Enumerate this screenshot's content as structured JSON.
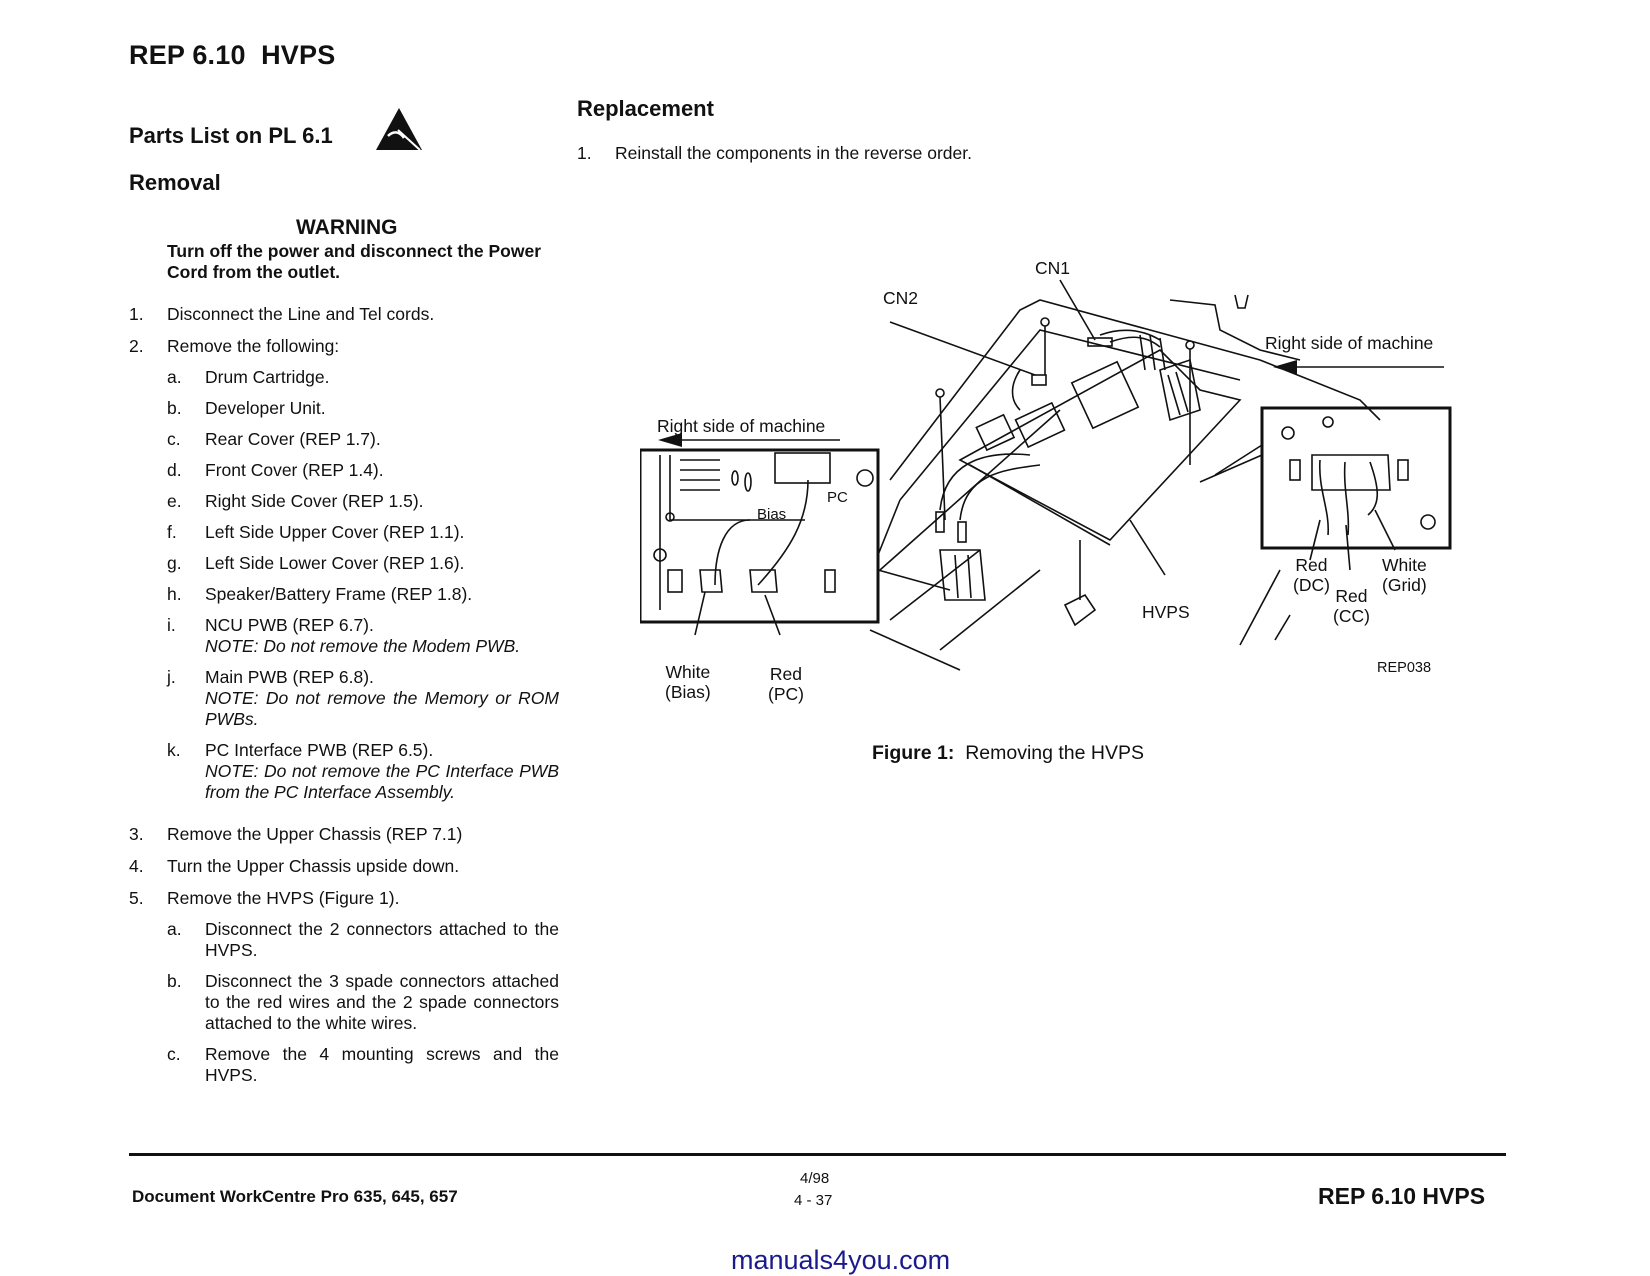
{
  "header": {
    "title": "REP 6.10  HVPS"
  },
  "left": {
    "parts_heading": "Parts List on PL 6.1",
    "esd_icon": "esd-warning-triangle-icon",
    "removal_heading": "Removal",
    "warning": {
      "title": "WARNING",
      "text": "Turn off the power and disconnect the Power Cord from the outlet."
    },
    "steps": [
      {
        "num": "1.",
        "text": "Disconnect the Line and Tel cords."
      },
      {
        "num": "2.",
        "text": "Remove the following:",
        "subs": [
          {
            "letter": "a.",
            "text": "Drum Cartridge."
          },
          {
            "letter": "b.",
            "text": "Developer Unit."
          },
          {
            "letter": "c.",
            "text": "Rear Cover (REP 1.7)."
          },
          {
            "letter": "d.",
            "text": "Front Cover (REP 1.4)."
          },
          {
            "letter": "e.",
            "text": "Right Side Cover (REP 1.5)."
          },
          {
            "letter": "f.",
            "text": "Left Side Upper Cover (REP 1.1)."
          },
          {
            "letter": "g.",
            "text": "Left Side Lower Cover (REP 1.6)."
          },
          {
            "letter": "h.",
            "text": "Speaker/Battery Frame (REP 1.8)."
          },
          {
            "letter": "i.",
            "text": "NCU PWB (REP 6.7).",
            "note": "NOTE: Do not remove the Modem PWB."
          },
          {
            "letter": "j.",
            "text": "Main PWB (REP 6.8).",
            "note": "NOTE: Do not remove the Memory or ROM PWBs."
          },
          {
            "letter": "k.",
            "text": "PC Interface PWB (REP 6.5).",
            "note": "NOTE: Do not remove the PC Interface PWB from the PC Interface Assembly."
          }
        ]
      },
      {
        "num": "3.",
        "text": "Remove the Upper Chassis (REP 7.1)"
      },
      {
        "num": "4.",
        "text": "Turn the Upper Chassis upside down."
      },
      {
        "num": "5.",
        "text": "Remove the HVPS (Figure 1).",
        "subs": [
          {
            "letter": "a.",
            "text": "Disconnect the 2 connectors attached to the HVPS."
          },
          {
            "letter": "b.",
            "text": "Disconnect the 3 spade connectors attached to the red wires and the 2 spade connectors attached to the white wires."
          },
          {
            "letter": "c.",
            "text": "Remove the 4 mounting screws and the HVPS."
          }
        ]
      }
    ]
  },
  "right": {
    "replacement_heading": "Replacement",
    "replacement_step": {
      "num": "1.",
      "text": "Reinstall the components in the reverse order."
    },
    "figure": {
      "labels": {
        "cn1": "CN1",
        "cn2": "CN2",
        "right_side_left": "Right side of machine",
        "right_side_right": "Right side of machine",
        "bias": "Bias",
        "pc": "PC",
        "white_bias": "White\n(Bias)",
        "red_pc": "Red\n(PC)",
        "hvps": "HVPS",
        "red_dc": "Red\n(DC)",
        "red_cc": "Red\n(CC)",
        "white_grid": "White\n(Grid)",
        "figure_id": "REP038"
      },
      "caption_label": "Figure 1:",
      "caption_text": "Removing the HVPS"
    }
  },
  "footer": {
    "product": "Document WorkCentre Pro 635, 645, 657",
    "date": "4/98",
    "page": "4 - 37",
    "section": "REP 6.10 HVPS"
  },
  "watermark": "manuals4you.com"
}
